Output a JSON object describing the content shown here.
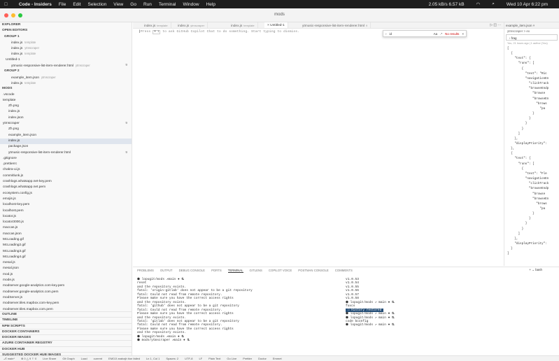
{
  "menubar": {
    "app": "Code - Insiders",
    "items": [
      "File",
      "Edit",
      "Selection",
      "View",
      "Go",
      "Run",
      "Terminal",
      "Window",
      "Help"
    ],
    "network": "2.05 kB/s 6.57 kB",
    "datetime": "Wed 10 Apr  6:22 pm"
  },
  "window": {
    "title": "mods"
  },
  "sidebar": {
    "explorer_title": "EXPLORER",
    "open_editors": "OPEN EDITORS",
    "group1": "GROUP 1",
    "group2": "GROUP 2",
    "open1": [
      {
        "name": "index.js",
        "desc": "template"
      },
      {
        "name": "index.js",
        "desc": "ytmscraper"
      },
      {
        "name": "index.js",
        "desc": "template"
      },
      {
        "name": "Untitled-1",
        "desc": ""
      },
      {
        "name": "ytmusic-responsive-list-item-renderer.html",
        "desc": "ytmscraper",
        "badge": "9"
      }
    ],
    "open2": [
      {
        "name": "example_item.json",
        "desc": "ytmscraper"
      },
      {
        "name": "index.js",
        "desc": "template"
      }
    ],
    "root": "MODS",
    "files": [
      {
        "name": ".vscode",
        "indent": 1
      },
      {
        "name": "template",
        "indent": 1
      },
      {
        "name": "Zh.png",
        "indent": 2
      },
      {
        "name": "index.js",
        "indent": 2
      },
      {
        "name": "index.json",
        "indent": 2
      },
      {
        "name": "ytmscraper",
        "indent": 1,
        "badge": "9"
      },
      {
        "name": "Zh.png",
        "indent": 2
      },
      {
        "name": "example_item.json",
        "indent": 2
      },
      {
        "name": "index.js",
        "indent": 2,
        "sel": true
      },
      {
        "name": "package.json",
        "indent": 2
      },
      {
        "name": "ytmusic-responsive-list-item-renderer.html",
        "indent": 2,
        "badge": "9"
      },
      {
        "name": ".gitignore",
        "indent": 1
      },
      {
        "name": ".prettierrc",
        "indent": 1
      },
      {
        "name": "chakra-ui.js",
        "indent": 1
      },
      {
        "name": "commitlunk.js",
        "indent": 1
      },
      {
        "name": "crashlogs.whatsapp.net-key.pem",
        "indent": 1
      },
      {
        "name": "crashlogs.whatsapp.net.pem",
        "indent": 1
      },
      {
        "name": "ecosystem.config.js",
        "indent": 1
      },
      {
        "name": "emojis.js",
        "indent": 1
      },
      {
        "name": "localhost-key.pem",
        "indent": 1
      },
      {
        "name": "localhost.pem",
        "indent": 1
      },
      {
        "name": "locator.js",
        "indent": 1
      },
      {
        "name": "locator3000.js",
        "indent": 1
      },
      {
        "name": "maccas.js",
        "indent": 1
      },
      {
        "name": "maccas.json",
        "indent": 1
      },
      {
        "name": "McLoading.gif",
        "indent": 1
      },
      {
        "name": "McLoading2.gif",
        "indent": 1
      },
      {
        "name": "McLoading3.gif",
        "indent": 1
      },
      {
        "name": "McLoading4.gif",
        "indent": 1
      },
      {
        "name": "mesal.js",
        "indent": 1
      },
      {
        "name": "mesal.json",
        "indent": 1
      },
      {
        "name": "mod.js",
        "indent": 1
      },
      {
        "name": "mode.js",
        "indent": 1
      },
      {
        "name": "modserver.google-analytics.com-key.pem",
        "indent": 1
      },
      {
        "name": "modserver.google-analytics.com.pem",
        "indent": 1
      },
      {
        "name": "modServer.js",
        "indent": 1
      },
      {
        "name": "modserver.tiles.mapbox.com-key.pem",
        "indent": 1
      },
      {
        "name": "modserver.tiles.mapbox.com.pem",
        "indent": 1
      }
    ],
    "bottom_sections": [
      "OUTLINE",
      "TIMELINE",
      "NPM SCRIPTS",
      "DOCKER CONTAINERS",
      "DOCKER IMAGES",
      "AZURE CONTAINER REGISTRY",
      "DOCKER HUB",
      "SUGGESTED DOCKER HUB IMAGES"
    ]
  },
  "tabs": [
    {
      "name": "index.js",
      "desc": "template"
    },
    {
      "name": "index.js",
      "desc": "ytmscraper"
    },
    {
      "name": "index.js",
      "desc": "template"
    },
    {
      "name": "Untitled-1",
      "desc": "",
      "active": true
    },
    {
      "name": "ytmusic-responsive-list-item-renderer.html",
      "desc": "9"
    }
  ],
  "editor": {
    "hint_pre": "Press",
    "hint_keys": "⌘ I",
    "hint_post": "to ask GitHub Copilot Chat to do something. Start typing to dismiss."
  },
  "find": {
    "value": "id",
    "result": "No results"
  },
  "right": {
    "tab": "example_item.json",
    "crumb": "ytmscraper > ex",
    "search": "frag",
    "meta": "You, 21 hours ago | 1 author (You)",
    "code": [
      "[",
      "  {",
      "    \"text\": {",
      "      \"runs\": [",
      "        {",
      "          \"text\": \"Ric",
      "          \"navigationEn",
      "            \"clickTrack",
      "            \"browseEndp",
      "              \"browse",
      "              \"browseEn",
      "                \"brows",
      "                  \"pa",
      "              }",
      "            }",
      "          }",
      "        }",
      "      ]",
      "    },",
      "    \"displayPriority\":",
      "  },",
      "  {",
      "    \"text\": {",
      "      \"runs\": [",
      "        {",
      "          \"text\": \"Fle",
      "          \"navigationEn",
      "            \"clickTrack",
      "            \"browseEndp",
      "              \"browse",
      "              \"browseEn",
      "                \"brows",
      "                  \"pa",
      "              }",
      "            }",
      "          }",
      "        }",
      "      ]",
      "    },",
      "    \"displayPriority\":",
      "  }",
      "]"
    ]
  },
  "panel": {
    "tabs": [
      "PROBLEMS",
      "OUTPUT",
      "DEBUG CONSOLE",
      "PORTS",
      "TERMINAL",
      "GITLENS",
      "COPILOT VOICE",
      "POSTMAN CONSOLE",
      "COMMENTS"
    ],
    "active": "TERMINAL",
    "shell": "bash",
    "left_lines": [
      "⬢ lopugit/mods ↗main ● ⛐",
      "reset",
      "and the repository exists.",
      "fatal: 'origin-gitlab' does not appear to be a git repository",
      "fatal: Could not read from remote repository.",
      "",
      "Please make sure you have the correct access rights",
      "and the repository exists.",
      "fatal: 'github' does not appear to be a git repository",
      "fatal: Could not read from remote repository.",
      "",
      "Please make sure you have the correct access rights",
      "and the repository exists.",
      "fatal: 'gitlab' does not appear to be a git repository",
      "fatal: Could not read from remote repository.",
      "",
      "Please make sure you have the correct access rights",
      "and the repository exists.",
      "⬢ lopugit/mods ↗main ● ⛐",
      "",
      "⬢ mods/ytmscraper ↗main ● ⛐"
    ],
    "right_lines": [
      "v1.0.53",
      "v1.0.54",
      "v1.0.55",
      "v1.0.56",
      "v1.0.57",
      "v1.0.58",
      "",
      "⬢ lopugit/mods ↗ main ● ⛐",
      "fuxcs",
      "",
      "⬢ lopugit/mods ↗ main ● ⛐",
      "",
      "",
      "⬢ lopugit/mods ↗ main ● ⛐",
      "code bconfig",
      "",
      "⬢ lopugit/mods ↗ main ● ⛐"
    ],
    "history": " ☐ History restored "
  },
  "status": [
    "⎇ main*",
    "⊗ 0 △ 9  ⚐ 0",
    "Live Share",
    "Git Graph",
    "Load",
    "current",
    "EMOJI arabajh tion failed",
    "Ln 1, Col 1",
    "Spaces: 2",
    "UTF-8",
    "LF",
    "Plain Text",
    "Go Live",
    "Prettier",
    "Doctor",
    "Emmet"
  ]
}
